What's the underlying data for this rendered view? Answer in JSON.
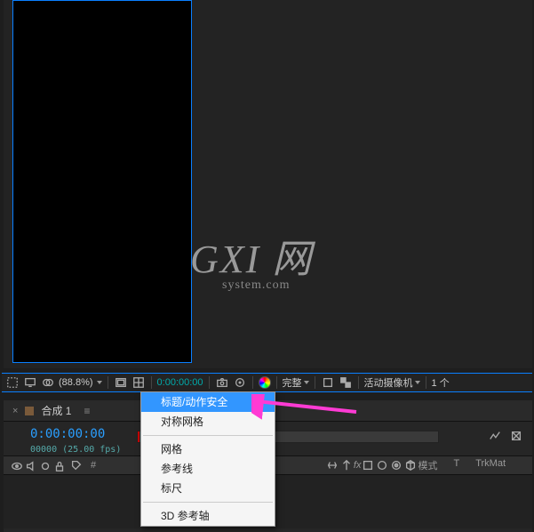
{
  "viewer": {
    "zoom_pct": "(88.8%)",
    "timecode": "0:00:00:00",
    "resolution": "完整",
    "camera": "活动摄像机",
    "count_suffix": "1 个"
  },
  "timeline": {
    "tab_name": "合成 1",
    "current_time": "0:00:00:00",
    "frame_info": "00000 (25.00 fps)",
    "col_hash": "#",
    "col_mode": "模式",
    "col_t": "T",
    "col_trkmat": "TrkMat"
  },
  "context_menu": {
    "items": [
      "标题/动作安全",
      "对称网格",
      "网格",
      "参考线",
      "标尺",
      "3D 参考轴"
    ]
  },
  "watermark": {
    "line1": "GXI 网",
    "line2": "system.com"
  }
}
